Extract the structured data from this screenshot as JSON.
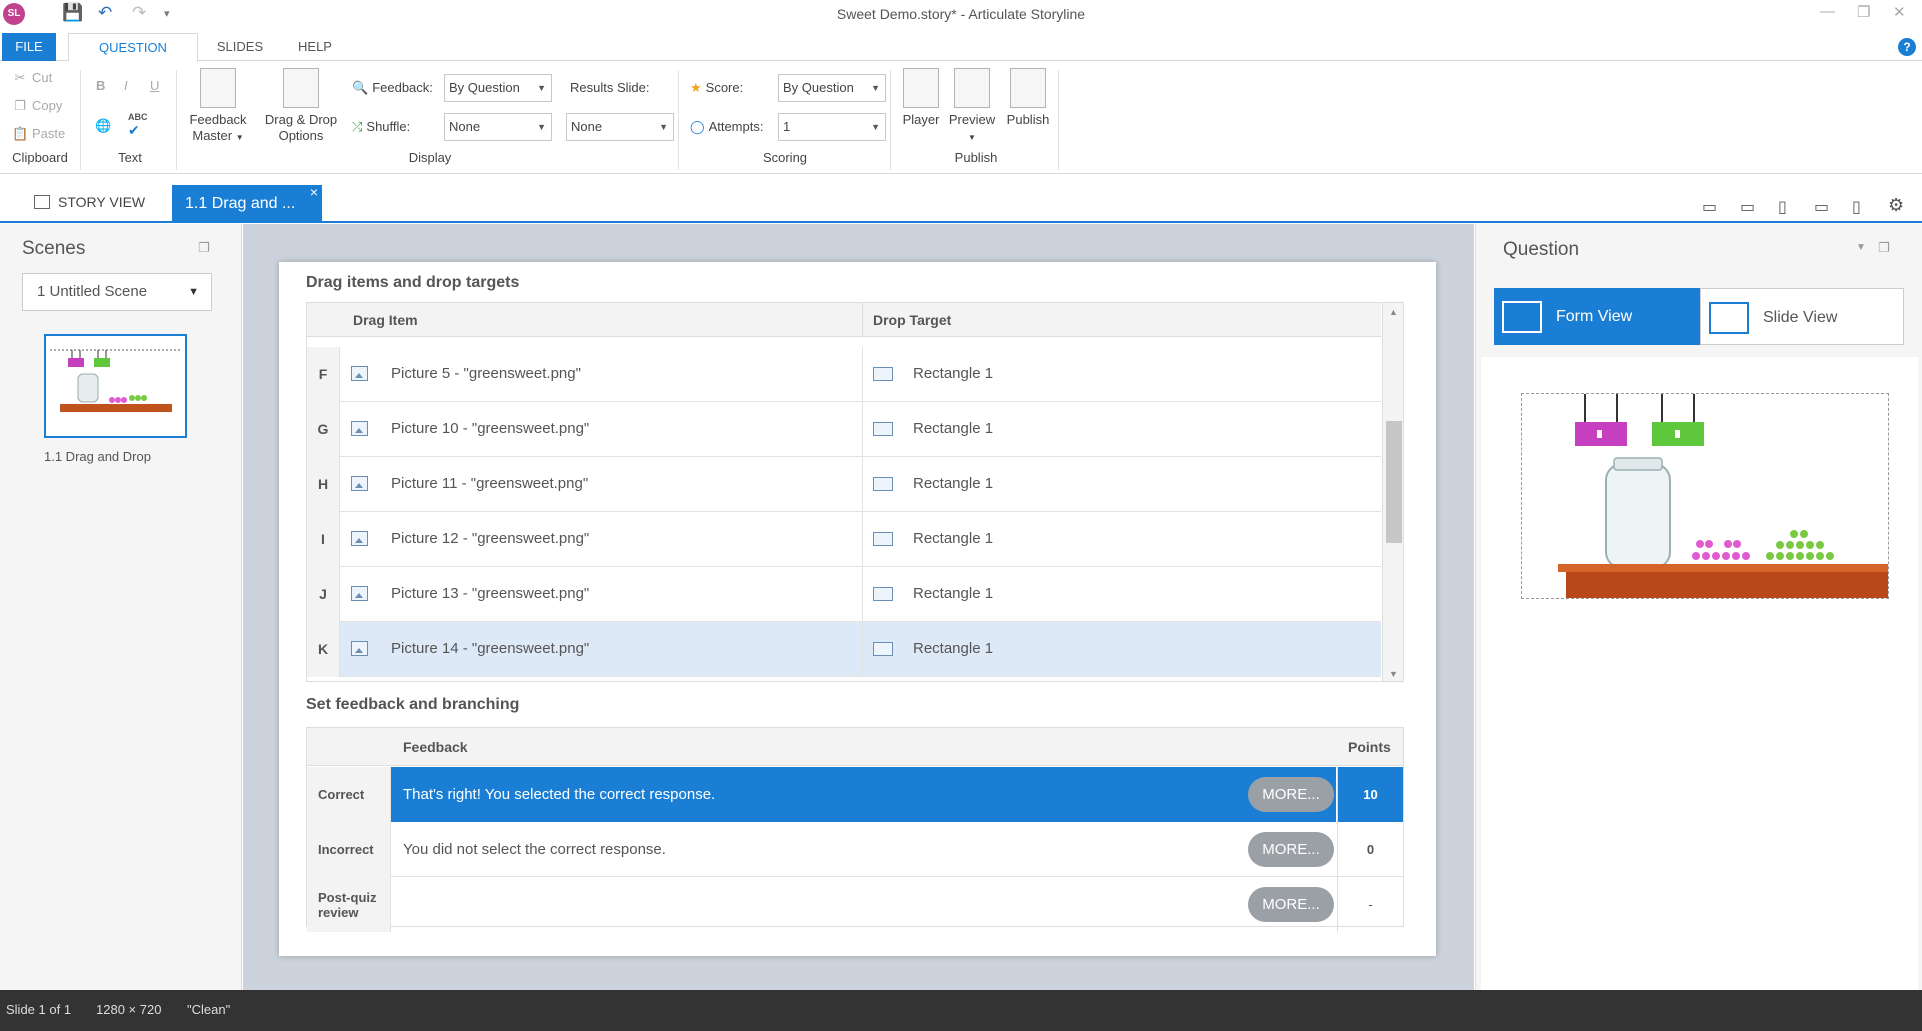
{
  "window": {
    "title": "Sweet Demo.story* -  Articulate Storyline",
    "logo_text": "SL"
  },
  "ribbon_tabs": {
    "file": "FILE",
    "question": "QUESTION",
    "slides": "SLIDES",
    "help": "HELP"
  },
  "clipboard": {
    "cut": "Cut",
    "copy": "Copy",
    "paste": "Paste",
    "group_label": "Clipboard"
  },
  "text_group": {
    "bold": "B",
    "italic": "I",
    "underline": "U",
    "spell": "ABC",
    "group_label": "Text"
  },
  "display": {
    "feedback_master_line1": "Feedback",
    "feedback_master_line2": "Master",
    "dd_options_line1": "Drag & Drop",
    "dd_options_line2": "Options",
    "feedback_label": "Feedback:",
    "feedback_value": "By Question",
    "shuffle_label": "Shuffle:",
    "shuffle_value": "None",
    "results_slide_label": "Results Slide:",
    "results_slide_value": "None",
    "group_label": "Display"
  },
  "scoring": {
    "score_label": "Score:",
    "score_value": "By Question",
    "attempts_label": "Attempts:",
    "attempts_value": "1",
    "group_label": "Scoring"
  },
  "publish": {
    "player": "Player",
    "preview": "Preview",
    "publish": "Publish",
    "group_label": "Publish"
  },
  "view_tabs": {
    "story_view": "STORY VIEW",
    "slide_tab": "1.1 Drag and ..."
  },
  "scenes": {
    "title": "Scenes",
    "selected_scene": "1 Untitled Scene",
    "thumbnail_label": "1.1 Drag and Drop"
  },
  "drag_section": {
    "title": "Drag items and drop targets",
    "col_item": "Drag Item",
    "col_target": "Drop Target",
    "rows": [
      {
        "key": "F",
        "item": "Picture 5 - \"greensweet.png\"",
        "target": "Rectangle 1"
      },
      {
        "key": "G",
        "item": "Picture 10 - \"greensweet.png\"",
        "target": "Rectangle 1"
      },
      {
        "key": "H",
        "item": "Picture 11 - \"greensweet.png\"",
        "target": "Rectangle 1"
      },
      {
        "key": "I",
        "item": "Picture 12 - \"greensweet.png\"",
        "target": "Rectangle 1"
      },
      {
        "key": "J",
        "item": "Picture 13 - \"greensweet.png\"",
        "target": "Rectangle 1"
      },
      {
        "key": "K",
        "item": "Picture 14 - \"greensweet.png\"",
        "target": "Rectangle 1"
      }
    ]
  },
  "feedback_section": {
    "title": "Set feedback and branching",
    "col_feedback": "Feedback",
    "col_points": "Points",
    "more_label": "MORE...",
    "rows": [
      {
        "label": "Correct",
        "text": "That's right!  You selected the correct response.",
        "points": "10"
      },
      {
        "label": "Incorrect",
        "text": "You did not select the correct response.",
        "points": "0"
      },
      {
        "label_line1": "Post-quiz",
        "label_line2": "review",
        "text": "",
        "points": "-"
      }
    ]
  },
  "question_panel": {
    "title": "Question",
    "form_view": "Form View",
    "slide_view": "Slide View"
  },
  "status": {
    "slide": "Slide 1 of 1",
    "size": "1280 × 720",
    "theme": "\"Clean\""
  },
  "colors": {
    "accent": "#1a7fd4",
    "status_bar": "#333333"
  }
}
